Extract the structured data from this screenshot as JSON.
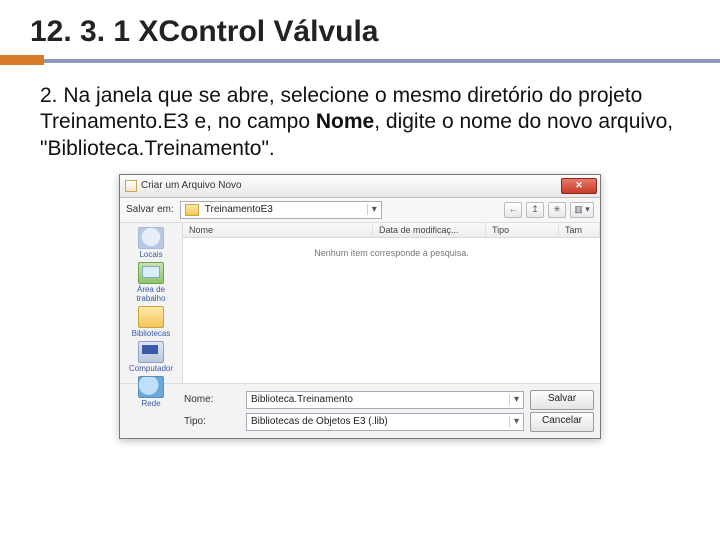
{
  "title": "12. 3. 1 XControl Válvula",
  "body": {
    "prefix": "2. Na janela que se abre, selecione o mesmo diretório do projeto Treinamento.E3 e, no campo ",
    "bold": "Nome",
    "suffix": ", digite o nome do novo arquivo, \"Biblioteca.Treinamento\"."
  },
  "dialog": {
    "title": "Criar um Arquivo Novo",
    "save_in_label": "Salvar em:",
    "save_in_value": "TreinamentoE3",
    "nav": {
      "back": "←",
      "up": "↥",
      "new": "✳",
      "views": "▥ ▾"
    },
    "places": [
      {
        "label": "Locais"
      },
      {
        "label": "Área de trabalho"
      },
      {
        "label": "Bibliotecas"
      },
      {
        "label": "Computador"
      },
      {
        "label": "Rede"
      }
    ],
    "columns": {
      "name": "Nome",
      "date": "Data de modificaç...",
      "type": "Tipo",
      "size": "Tam"
    },
    "empty_text": "Nenhum item corresponde à pesquisa.",
    "name_label": "Nome:",
    "name_value": "Biblioteca.Treinamento",
    "type_label": "Tipo:",
    "type_value": "Bibliotecas de Objetos E3 (.lib)",
    "save_btn": "Salvar",
    "cancel_btn": "Cancelar"
  }
}
